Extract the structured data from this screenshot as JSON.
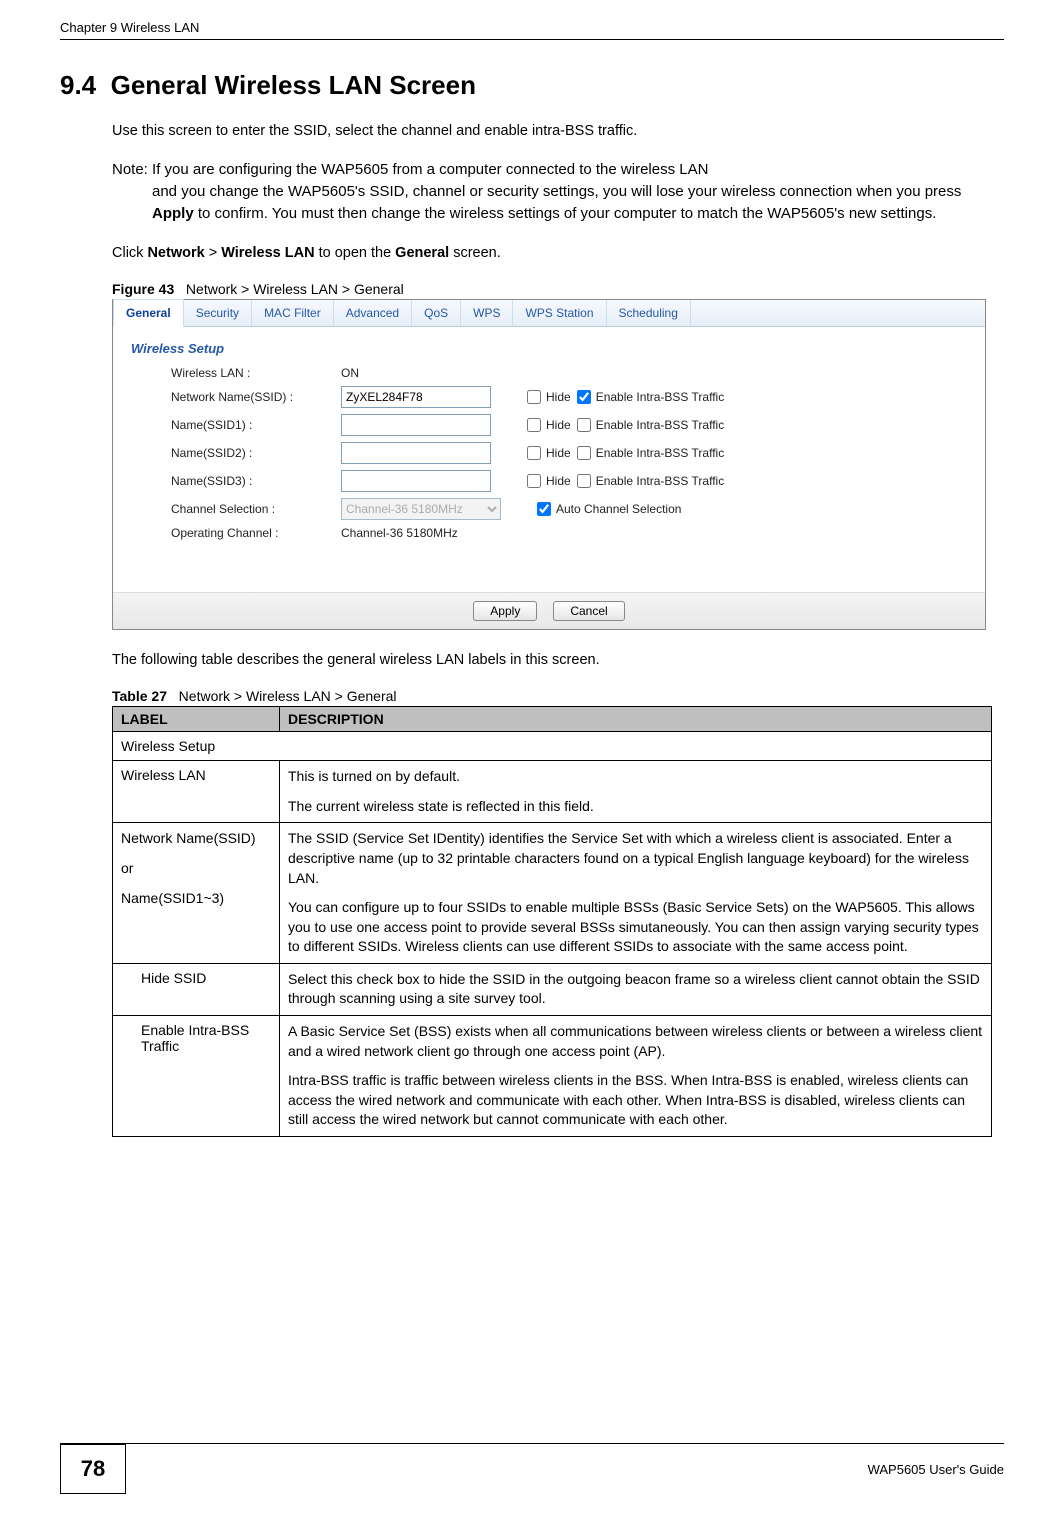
{
  "chapter_header": "Chapter 9 Wireless LAN",
  "section_number": "9.4",
  "section_title": "General Wireless LAN Screen",
  "intro": "Use this screen to enter the SSID, select the channel and enable intra-BSS traffic.",
  "note_prefix": "Note: ",
  "note_first_line": "If you are configuring the WAP5605 from a computer connected to the wireless LAN",
  "note_rest": "and you change the WAP5605's SSID, channel or security settings, you will lose your wireless connection when you press Apply to confirm. You must then change the wireless settings of your computer to match the WAP5605's new settings.",
  "note_bold_word": "Apply",
  "click_line_pre": "Click ",
  "click_bold1": "Network",
  "click_gt": " > ",
  "click_bold2": "Wireless LAN",
  "click_mid": " to open the ",
  "click_bold3": "General",
  "click_post": " screen.",
  "figure_label": "Figure 43",
  "figure_caption": "Network > Wireless LAN > General",
  "tabs": [
    "General",
    "Security",
    "MAC Filter",
    "Advanced",
    "QoS",
    "WPS",
    "WPS Station",
    "Scheduling"
  ],
  "panel_title": "Wireless Setup",
  "form": {
    "wlan_label": "Wireless LAN :",
    "wlan_value": "ON",
    "ssid_label": "Network Name(SSID) :",
    "ssid_value": "ZyXEL284F78",
    "ssid1_label": "Name(SSID1) :",
    "ssid1_value": "",
    "ssid2_label": "Name(SSID2) :",
    "ssid2_value": "",
    "ssid3_label": "Name(SSID3) :",
    "ssid3_value": "",
    "hide_label": "Hide",
    "intra_label": "Enable Intra-BSS Traffic",
    "chan_sel_label": "Channel Selection :",
    "chan_sel_value": "Channel-36 5180MHz",
    "auto_chan_label": "Auto Channel Selection",
    "oper_chan_label": "Operating Channel :",
    "oper_chan_value": "Channel-36 5180MHz",
    "apply": "Apply",
    "cancel": "Cancel"
  },
  "table_intro": "The following table describes the general wireless LAN labels in this screen.",
  "table_label": "Table 27",
  "table_caption": "Network > Wireless LAN > General",
  "table_headers": {
    "label": "LABEL",
    "desc": "DESCRIPTION"
  },
  "rows": {
    "wsetup": "Wireless Setup",
    "wlan_l": "Wireless LAN",
    "wlan_d1": "This is turned on by default.",
    "wlan_d2": "The current wireless state is reflected in this field.",
    "ssid_l1": "Network Name(SSID)",
    "ssid_l2": "or",
    "ssid_l3": "Name(SSID1~3)",
    "ssid_d1": "The SSID (Service Set IDentity) identifies the Service Set with which a wireless client is associated. Enter a descriptive name (up to 32 printable characters found on a typical English language keyboard) for the wireless LAN.",
    "ssid_d2": "You can configure up to four SSIDs to enable multiple BSSs (Basic Service Sets) on the WAP5605. This allows you to use one access point to provide several BSSs simutaneously. You can then assign varying security types to different SSIDs. Wireless clients can use different SSIDs to associate with the same access point.",
    "hide_l": "Hide SSID",
    "hide_d": "Select this check box to hide the SSID in the outgoing beacon frame so a wireless client cannot obtain the SSID through scanning using a site survey tool.",
    "intra_l": "Enable Intra-BSS Traffic",
    "intra_d1": "A Basic Service Set (BSS) exists when all communications between wireless clients or between a wireless client and a wired network client go through one access point (AP).",
    "intra_d2": "Intra-BSS traffic is traffic between wireless clients in the BSS. When Intra-BSS is enabled, wireless clients can access the wired network and communicate with each other. When Intra-BSS is disabled, wireless clients can still access the wired network but cannot communicate with each other."
  },
  "page_number": "78",
  "guide_name": "WAP5605 User's Guide"
}
